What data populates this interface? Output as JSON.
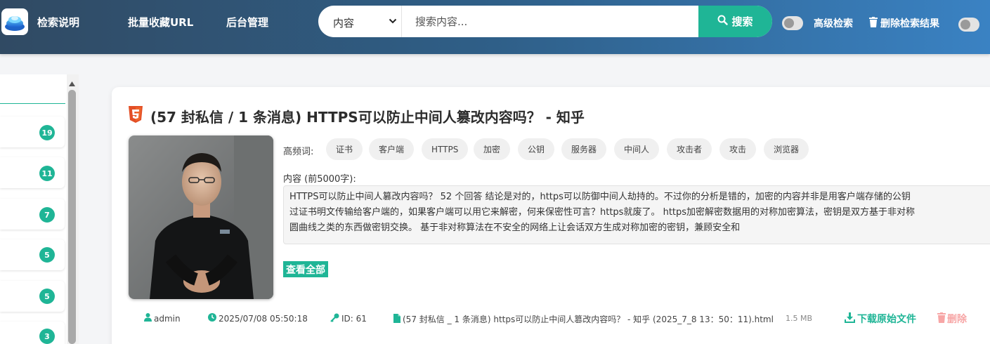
{
  "nav": {
    "links": [
      "检索说明",
      "批量收藏URL",
      "后台管理"
    ]
  },
  "search": {
    "field_selected": "内容",
    "placeholder": "搜索内容...",
    "button_label": "搜索"
  },
  "toolbar": {
    "advanced_label": "高级检索",
    "delete_results_label": "删除检索结果"
  },
  "sidebar": {
    "counts": [
      "19",
      "11",
      "7",
      "5",
      "5",
      "3"
    ]
  },
  "result": {
    "title": "(57 封私信 / 1 条消息) HTTPS可以防止中间人篡改内容吗？ - 知乎",
    "keywords_label": "高频词:",
    "keywords": [
      "证书",
      "客户端",
      "HTTPS",
      "加密",
      "公钥",
      "服务器",
      "中间人",
      "攻击者",
      "攻击",
      "浏览器"
    ],
    "content_label": "内容 (前5000字):",
    "content_lines": [
      "HTTPS可以防止中间人篡改内容吗？ 52 个回答 结论是对的，https可以防御中间人劫持的。不过你的分析是错的，加密的内容并非是用客户端存储的公钥",
      "过证书明文传输给客户端的，如果客户端可以用它来解密，何来保密性可言？https就废了。 https加密解密数据用的对称加密算法，密钥是双方基于非对称",
      "圆曲线之类的东西做密钥交换。 基于非对称算法在不安全的网络上让会话双方生成对称加密的密钥，兼顾安全和"
    ],
    "view_all_label": "查看全部",
    "meta": {
      "user": "admin",
      "datetime": "2025/07/08 05:50:18",
      "id": "ID: 61",
      "filename": "(57 封私信 _ 1 条消息) https可以防止中间人篡改内容吗？ - 知乎 (2025_7_8 13：50：11).html",
      "size": "1.5 MB"
    },
    "download_label": "下载原始文件",
    "delete_label": "删除"
  },
  "colors": {
    "accent": "#1fb596",
    "delete": "#f7a6a6",
    "nav_gradient_start": "#304a63",
    "nav_gradient_end": "#3a82c3"
  },
  "icons": [
    "app-logo",
    "chevron-down-icon",
    "search-icon",
    "trash-icon",
    "html5-icon",
    "user-icon",
    "clock-icon",
    "key-icon",
    "file-icon",
    "download-icon"
  ]
}
